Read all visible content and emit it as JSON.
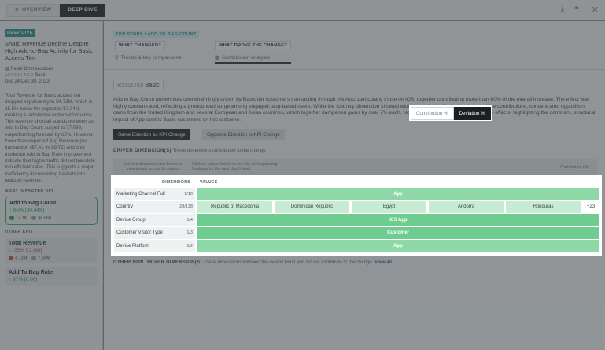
{
  "topbar": {
    "tab_overview": "OVERVIEW",
    "tab_deep_dive": "DEEP DIVE"
  },
  "sidebar": {
    "badge": "DEEP DIVE",
    "title": "Sharp Revenue Decline Despite High Add-to-Bag Activity for Basic Access Tier",
    "meta": {
      "product": "Retail Omnisessions",
      "tier_key": "ACCESS TIER",
      "tier_value": "Basic",
      "date_range": "Dec 24-Dec 30, 2023"
    },
    "body": "Total Revenue for Basic access tier dropped significantly to $4.73M, which is 35.5% below the expected $7.34M, marking a substantial underperformance. This revenue shortfall stands out even as Add to Bag Count surged to 77,099, outperforming forecast by 65%. However, lower than expected Avg Revenue per transaction ($7.41 vs $9.72) and only moderate Add to Bag Rate improvement indicate that higher traffic did not translate into efficient sales. This suggests a major inefficiency in converting baskets into realized revenue.",
    "most_impacted": "MOST IMPACTED KPI",
    "other_kpis": "OTHER KPIs",
    "kpis": [
      {
        "name": "Add to Bag Count",
        "delta": "↑ 65% [30.44K]",
        "actual": "77.1K",
        "expected": "46.66K"
      },
      {
        "name": "Total Revenue",
        "delta": "↓ -35% [-2.6M]",
        "actual": "4.73M",
        "expected": "7.34M"
      },
      {
        "name": "Add To Bag Rate",
        "delta": "↑ 97% [0.06]"
      }
    ]
  },
  "main": {
    "story_label": "TOP STORY / ADD TO BAG COUNT",
    "q1": {
      "label": "WHAT CHANGED?",
      "sub": "Trends & key comparisons"
    },
    "q2": {
      "label": "WHAT DROVE THE CHANGE?",
      "sub": "Contribution Analysis"
    },
    "access_key": "ACCESS TIER",
    "access_value": "Basic",
    "paragraph": "Add to Bag Count growth was overwhelmingly driven by Basic tier customers transacting through the App, particularly those on iOS, together contributing more than 60% of the overall increase. The effect was highly concentrated, reflecting a pronounced surge among engaged, app-based users. While the Country dimension showed widespread but individually minor positive contributions, concentrated opposition came from the United Kingdom and several European and Asian countries, which together dampened gains by over 7% each. No material movement followed as side effects, highlighting the dominant, structural impact of App-centric Basic customers on this outcome.",
    "dir_same": "Same Direction as KPI Change",
    "dir_opposite": "Opposite Direction to KPI Change",
    "toggle_contribution": "Contribution %",
    "toggle_deviation": "Deviation %",
    "driver_title": "DRIVER DIMENSION(S)",
    "driver_desc": "These dimensions contributed to the change",
    "hint1": "Select a dimension row below to view trends across its values",
    "hint2": "Click on values below to see the corresponding heatmap for the next depth level",
    "hint3": "Contribution (%)",
    "table": {
      "col_dimensions": "DIMENSIONS",
      "col_values": "VALUES",
      "rows": [
        {
          "dim": "Marketing Channel Full",
          "count": "1/10",
          "values": [
            "App"
          ]
        },
        {
          "dim": "Country",
          "count": "28/138",
          "values": [
            "Republic of Macedonia",
            "Dominican Republic",
            "Egypt",
            "Andorra",
            "Honduras"
          ],
          "more": "+23"
        },
        {
          "dim": "Device Group",
          "count": "1/4",
          "values": [
            "iOS App"
          ]
        },
        {
          "dim": "Customer Visitor Type",
          "count": "1/3",
          "values": [
            "Customer"
          ]
        },
        {
          "dim": "Device Platform",
          "count": "1/2",
          "values": [
            "App"
          ]
        }
      ]
    },
    "other_title": "OTHER NON DRIVER DIMENSION(S)",
    "other_desc": "These dimensions followed the overall trend and did not contribute to the change.",
    "view_all": "View all"
  }
}
